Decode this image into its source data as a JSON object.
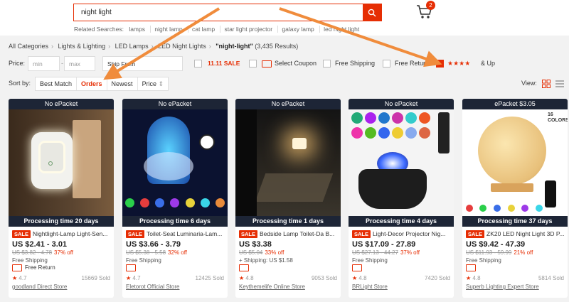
{
  "search": {
    "value": "night light",
    "related_label": "Related Searches:",
    "related": [
      "lamps",
      "night lamp",
      "cat lamp",
      "star light projector",
      "galaxy lamp",
      "led night light"
    ]
  },
  "cart": {
    "count": "2"
  },
  "breadcrumb": {
    "items": [
      "All Categories",
      "Lights & Lighting",
      "LED Lamps",
      "LED Night Lights"
    ],
    "query": "\"night-light\"",
    "results": "(3,435 Results)"
  },
  "filters": {
    "price_label": "Price:",
    "min_placeholder": "min",
    "max_placeholder": "max",
    "dash": "-",
    "ship_from": "Ship From",
    "sale_badge": "11.11 SALE",
    "select_coupon": "Select Coupon",
    "free_shipping": "Free Shipping",
    "free_return": "Free Return",
    "rating_suffix": "& Up",
    "rating_stars": "★★★★"
  },
  "sort": {
    "label": "Sort by:",
    "options": [
      "Best Match",
      "Orders",
      "Newest",
      "Price"
    ],
    "active": "Orders",
    "price_icon": "⇕"
  },
  "view": {
    "label": "View:"
  },
  "colors": {
    "accent": "#e62e04",
    "dark_band": "#1d2536",
    "arrow": "#f08c3c"
  },
  "products": [
    {
      "band": "No ePacket",
      "processing": "Processing time 20 days",
      "sale": "SALE",
      "title": "Nightlight-Lamp Light-Sen...",
      "price": "US $2.41 - 3.01",
      "orig": "US $3.82 - 4.78",
      "discount": "37% off",
      "shipping": "Free Shipping",
      "free_return": "Free Return",
      "stars": "★",
      "rating": "4.7",
      "sold": "15669 Sold",
      "store": "goodland Direct Store"
    },
    {
      "band": "No ePacket",
      "processing": "Processing time 6 days",
      "sale": "SALE",
      "title": "Toilet-Seat Luminaria-Lam...",
      "price": "US $3.66 - 3.79",
      "orig": "US $5.38 - 5.58",
      "discount": "32% off",
      "shipping": "Free Shipping",
      "free_return": "",
      "stars": "★",
      "rating": "4.7",
      "sold": "12425 Sold",
      "store": "Eletorot Official Store"
    },
    {
      "band": "No ePacket",
      "processing": "Processing time 1 days",
      "sale": "SALE",
      "title": "Bedside Lamp Toilet-Da B...",
      "price": "US $3.38",
      "orig": "US $5.04",
      "discount": "33% off",
      "shipping": "+ Shipping: US $1.58",
      "free_return": "",
      "stars": "★",
      "rating": "4.8",
      "sold": "9053 Sold",
      "store": "Keythemelife Online Store"
    },
    {
      "band": "No ePacket",
      "processing": "Processing time 4 days",
      "sale": "SALE",
      "title": "Light-Decor Projector Nig...",
      "price": "US $17.09 - 27.89",
      "orig": "US $27.13 - 44.27",
      "discount": "37% off",
      "shipping": "Free Shipping",
      "free_return": "",
      "stars": "★",
      "rating": "4.8",
      "sold": "7420 Sold",
      "store": "BRLight Store"
    },
    {
      "band": "ePacket $3.05",
      "processing": "Processing time 37 days",
      "sale": "SALE",
      "title": "ZK20 LED Night Light 3D P...",
      "price": "US $9.42 - 47.39",
      "orig": "US $11.93 - 59.99",
      "discount": "21% off",
      "shipping": "Free Shipping",
      "free_return": "",
      "stars": "★",
      "rating": "4.8",
      "sold": "5814 Sold",
      "store": "Superb Lighting Expert Store",
      "image_text": "16 COLORS"
    }
  ]
}
